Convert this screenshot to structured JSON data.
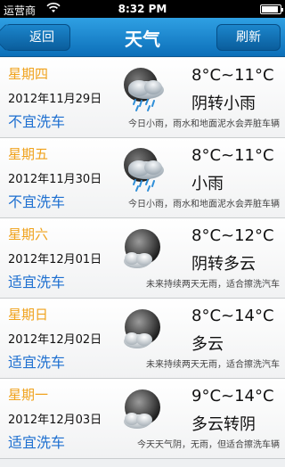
{
  "status_bar": {
    "carrier": "运营商",
    "time": "8:32 PM",
    "battery_level": 0.9
  },
  "nav": {
    "back_label": "返回",
    "title": "天气",
    "refresh_label": "刷新"
  },
  "days": [
    {
      "weekday": "星期四",
      "date": "2012年11月29日",
      "wash": "不宜洗车",
      "temp": "8°C~11°C",
      "condition": "阴转小雨",
      "advice": "今日小雨，雨水和地面泥水会弄脏车辆",
      "icon": "rain-cloud-icon"
    },
    {
      "weekday": "星期五",
      "date": "2012年11月30日",
      "wash": "不宜洗车",
      "temp": "8°C~11°C",
      "condition": "小雨",
      "advice": "今日小雨，雨水和地面泥水会弄脏车辆",
      "icon": "rain-cloud-icon"
    },
    {
      "weekday": "星期六",
      "date": "2012年12月01日",
      "wash": "适宜洗车",
      "temp": "8°C~12°C",
      "condition": "阴转多云",
      "advice": "未来持续两天无雨，适合擦洗汽车",
      "icon": "moon-cloud-icon"
    },
    {
      "weekday": "星期日",
      "date": "2012年12月02日",
      "wash": "适宜洗车",
      "temp": "8°C~14°C",
      "condition": "多云",
      "advice": "未来持续两天无雨，适合擦洗汽车",
      "icon": "moon-cloud-icon"
    },
    {
      "weekday": "星期一",
      "date": "2012年12月03日",
      "wash": "适宜洗车",
      "temp": "9°C~14°C",
      "condition": "多云转阴",
      "advice": "今天天气阴，无雨，但适合擦洗车辆",
      "icon": "moon-cloud-icon"
    }
  ]
}
